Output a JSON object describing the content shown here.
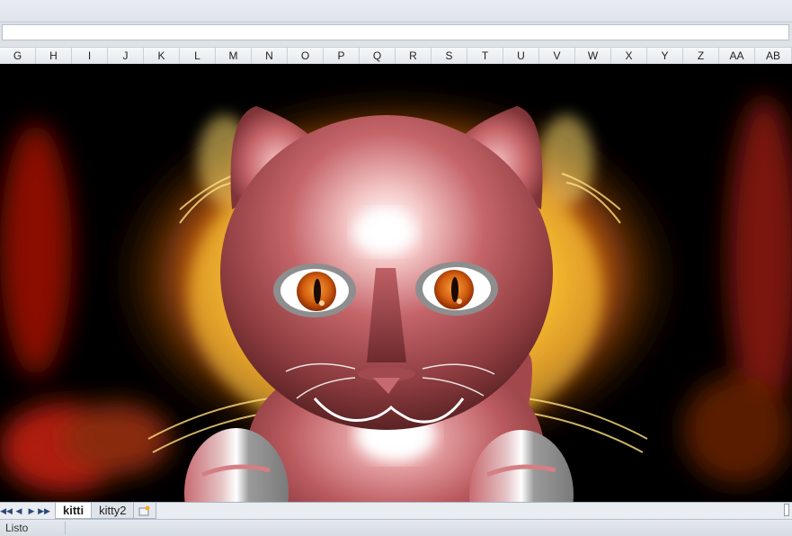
{
  "columns": [
    "G",
    "H",
    "I",
    "J",
    "K",
    "L",
    "M",
    "N",
    "O",
    "P",
    "Q",
    "R",
    "S",
    "T",
    "U",
    "V",
    "W",
    "X",
    "Y",
    "Z",
    "AA",
    "AB"
  ],
  "sheet_tabs": [
    {
      "label": "kitti",
      "active": true
    },
    {
      "label": "kitty2",
      "active": false
    }
  ],
  "status": {
    "ready_text": "Listo"
  },
  "artwork": {
    "subject": "cat",
    "palette": {
      "body": "#b8555b",
      "eyes": "#e06a10",
      "glow": "#ffd030",
      "background": "#000000"
    }
  }
}
